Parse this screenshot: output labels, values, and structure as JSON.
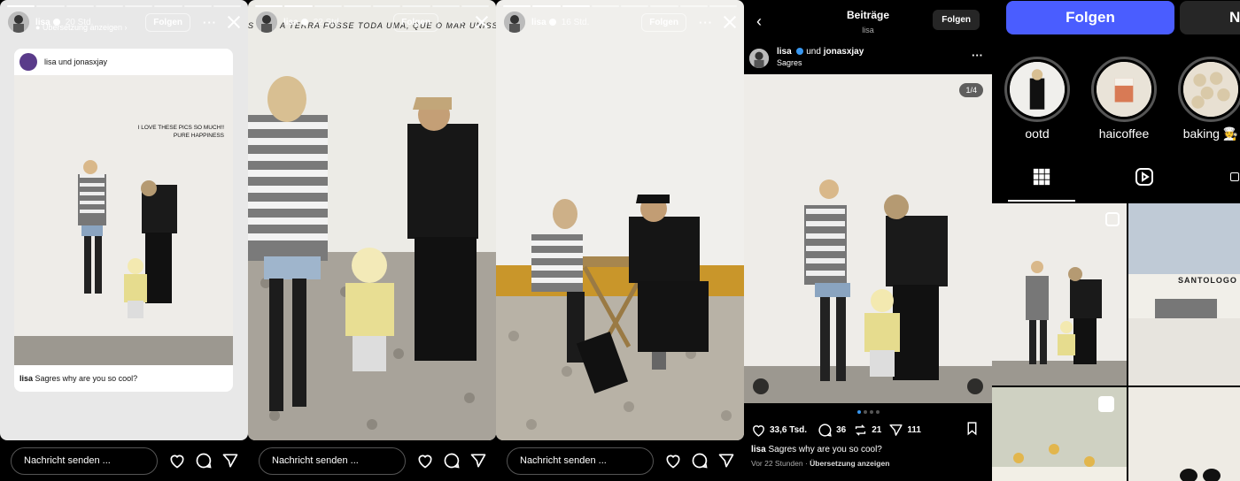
{
  "stories": [
    {
      "user": "lisa",
      "time": "20 Std.",
      "follow": "Folgen",
      "translate": "Übersetzung anzeigen",
      "progress_active": 1,
      "card": {
        "header": "lisa und jonasxjay",
        "overlay_line1": "I LOVE THESE PICS SO MUCH!!",
        "overlay_line2": "PURE HAPPINESS",
        "caption_user": "lisa",
        "caption_text": "Sagres why are you so cool?"
      }
    },
    {
      "user": "lisa",
      "time": "22 Std.",
      "follow": "Folgen",
      "overlay_text": "S QUE A TERRA FOSSE TODA UMA, QUE O MAR UNISSE, JA N",
      "progress_active": 2
    },
    {
      "user": "lisa",
      "time": "16 Std.",
      "follow": "Folgen",
      "progress_active": 3
    }
  ],
  "message": {
    "placeholder": "Nachricht senden ..."
  },
  "post": {
    "title": "Beiträge",
    "subtitle": "lisa",
    "follow": "Folgen",
    "user": "lisa",
    "coauthor_join": "und",
    "coauthor": "jonasxjay",
    "location": "Sagres",
    "counter": "1/4",
    "likes": "33,6 Tsd.",
    "comments": "36",
    "reposts": "21",
    "shares": "111",
    "caption_user": "lisa",
    "caption_text": "Sagres why are you so cool?",
    "time": "Vor 22 Stunden",
    "translate": "Übersetzung anzeigen"
  },
  "profile": {
    "follow": "Folgen",
    "next_button": "N",
    "highlights": [
      "ootd",
      "haicoffee",
      "baking 🧑‍🍳"
    ],
    "grid_sign": "SANTOLOGO"
  },
  "colors": {
    "accent": "#4a5dff",
    "verified": "#3897f0"
  }
}
